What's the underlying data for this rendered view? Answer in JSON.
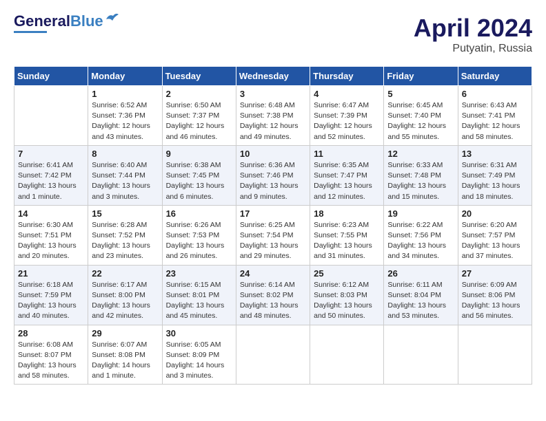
{
  "header": {
    "logo_general": "General",
    "logo_blue": "Blue",
    "title": "April 2024",
    "location": "Putyatin, Russia"
  },
  "calendar": {
    "days_of_week": [
      "Sunday",
      "Monday",
      "Tuesday",
      "Wednesday",
      "Thursday",
      "Friday",
      "Saturday"
    ],
    "weeks": [
      [
        {
          "day": "",
          "content": ""
        },
        {
          "day": "1",
          "content": "Sunrise: 6:52 AM\nSunset: 7:36 PM\nDaylight: 12 hours\nand 43 minutes."
        },
        {
          "day": "2",
          "content": "Sunrise: 6:50 AM\nSunset: 7:37 PM\nDaylight: 12 hours\nand 46 minutes."
        },
        {
          "day": "3",
          "content": "Sunrise: 6:48 AM\nSunset: 7:38 PM\nDaylight: 12 hours\nand 49 minutes."
        },
        {
          "day": "4",
          "content": "Sunrise: 6:47 AM\nSunset: 7:39 PM\nDaylight: 12 hours\nand 52 minutes."
        },
        {
          "day": "5",
          "content": "Sunrise: 6:45 AM\nSunset: 7:40 PM\nDaylight: 12 hours\nand 55 minutes."
        },
        {
          "day": "6",
          "content": "Sunrise: 6:43 AM\nSunset: 7:41 PM\nDaylight: 12 hours\nand 58 minutes."
        }
      ],
      [
        {
          "day": "7",
          "content": "Sunrise: 6:41 AM\nSunset: 7:42 PM\nDaylight: 13 hours\nand 1 minute."
        },
        {
          "day": "8",
          "content": "Sunrise: 6:40 AM\nSunset: 7:44 PM\nDaylight: 13 hours\nand 3 minutes."
        },
        {
          "day": "9",
          "content": "Sunrise: 6:38 AM\nSunset: 7:45 PM\nDaylight: 13 hours\nand 6 minutes."
        },
        {
          "day": "10",
          "content": "Sunrise: 6:36 AM\nSunset: 7:46 PM\nDaylight: 13 hours\nand 9 minutes."
        },
        {
          "day": "11",
          "content": "Sunrise: 6:35 AM\nSunset: 7:47 PM\nDaylight: 13 hours\nand 12 minutes."
        },
        {
          "day": "12",
          "content": "Sunrise: 6:33 AM\nSunset: 7:48 PM\nDaylight: 13 hours\nand 15 minutes."
        },
        {
          "day": "13",
          "content": "Sunrise: 6:31 AM\nSunset: 7:49 PM\nDaylight: 13 hours\nand 18 minutes."
        }
      ],
      [
        {
          "day": "14",
          "content": "Sunrise: 6:30 AM\nSunset: 7:51 PM\nDaylight: 13 hours\nand 20 minutes."
        },
        {
          "day": "15",
          "content": "Sunrise: 6:28 AM\nSunset: 7:52 PM\nDaylight: 13 hours\nand 23 minutes."
        },
        {
          "day": "16",
          "content": "Sunrise: 6:26 AM\nSunset: 7:53 PM\nDaylight: 13 hours\nand 26 minutes."
        },
        {
          "day": "17",
          "content": "Sunrise: 6:25 AM\nSunset: 7:54 PM\nDaylight: 13 hours\nand 29 minutes."
        },
        {
          "day": "18",
          "content": "Sunrise: 6:23 AM\nSunset: 7:55 PM\nDaylight: 13 hours\nand 31 minutes."
        },
        {
          "day": "19",
          "content": "Sunrise: 6:22 AM\nSunset: 7:56 PM\nDaylight: 13 hours\nand 34 minutes."
        },
        {
          "day": "20",
          "content": "Sunrise: 6:20 AM\nSunset: 7:57 PM\nDaylight: 13 hours\nand 37 minutes."
        }
      ],
      [
        {
          "day": "21",
          "content": "Sunrise: 6:18 AM\nSunset: 7:59 PM\nDaylight: 13 hours\nand 40 minutes."
        },
        {
          "day": "22",
          "content": "Sunrise: 6:17 AM\nSunset: 8:00 PM\nDaylight: 13 hours\nand 42 minutes."
        },
        {
          "day": "23",
          "content": "Sunrise: 6:15 AM\nSunset: 8:01 PM\nDaylight: 13 hours\nand 45 minutes."
        },
        {
          "day": "24",
          "content": "Sunrise: 6:14 AM\nSunset: 8:02 PM\nDaylight: 13 hours\nand 48 minutes."
        },
        {
          "day": "25",
          "content": "Sunrise: 6:12 AM\nSunset: 8:03 PM\nDaylight: 13 hours\nand 50 minutes."
        },
        {
          "day": "26",
          "content": "Sunrise: 6:11 AM\nSunset: 8:04 PM\nDaylight: 13 hours\nand 53 minutes."
        },
        {
          "day": "27",
          "content": "Sunrise: 6:09 AM\nSunset: 8:06 PM\nDaylight: 13 hours\nand 56 minutes."
        }
      ],
      [
        {
          "day": "28",
          "content": "Sunrise: 6:08 AM\nSunset: 8:07 PM\nDaylight: 13 hours\nand 58 minutes."
        },
        {
          "day": "29",
          "content": "Sunrise: 6:07 AM\nSunset: 8:08 PM\nDaylight: 14 hours\nand 1 minute."
        },
        {
          "day": "30",
          "content": "Sunrise: 6:05 AM\nSunset: 8:09 PM\nDaylight: 14 hours\nand 3 minutes."
        },
        {
          "day": "",
          "content": ""
        },
        {
          "day": "",
          "content": ""
        },
        {
          "day": "",
          "content": ""
        },
        {
          "day": "",
          "content": ""
        }
      ]
    ]
  }
}
